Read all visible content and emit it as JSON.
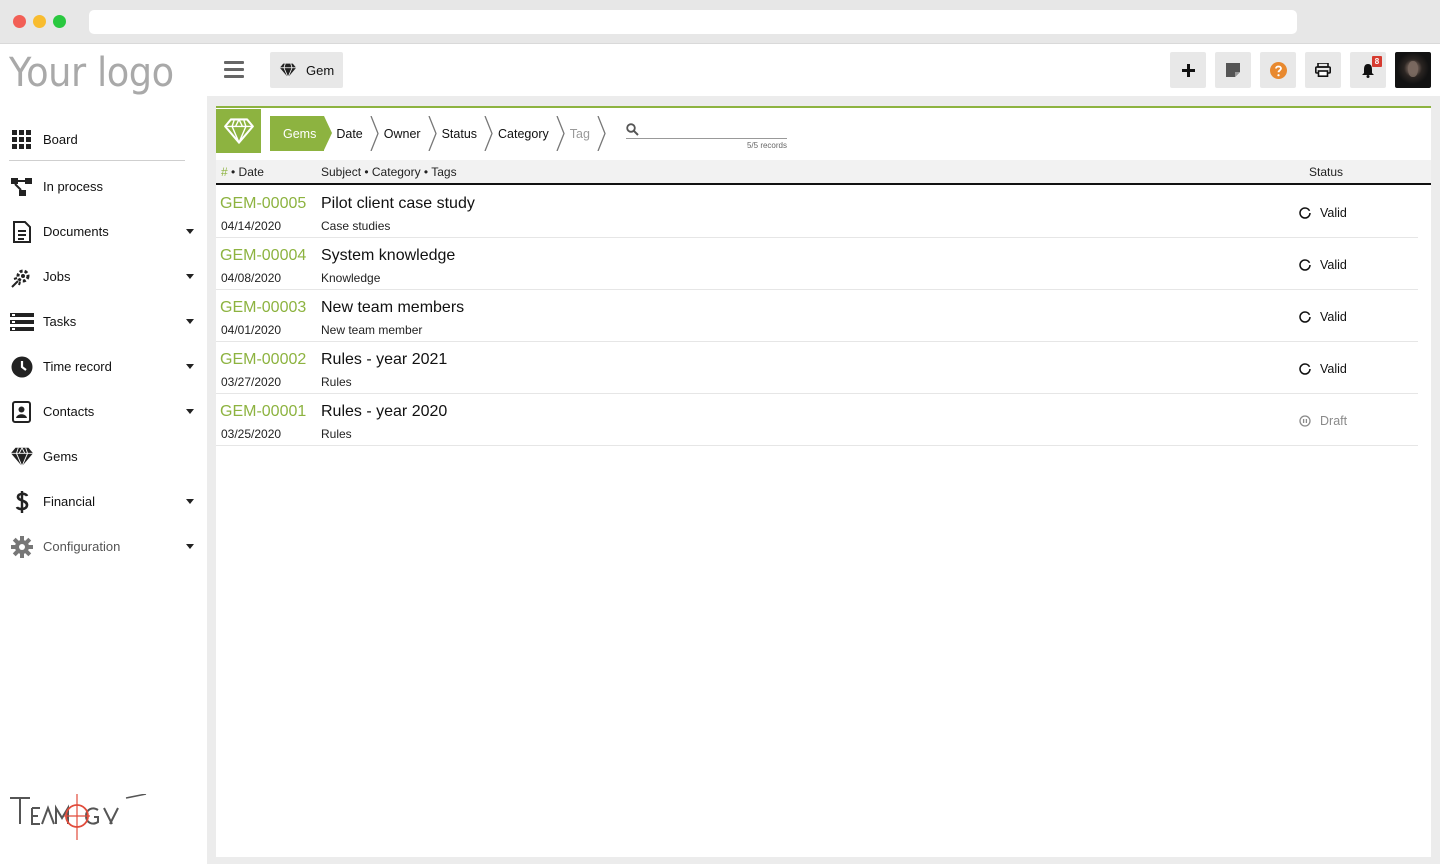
{
  "app": {
    "logo_text": "Your logo",
    "brand_text": "TEAMOLOGY"
  },
  "topbar": {
    "module_label": "Gem",
    "notification_count": "8",
    "buttons": [
      "add",
      "note",
      "help",
      "print",
      "notifications"
    ]
  },
  "sidebar": {
    "items": [
      {
        "label": "Board",
        "icon": "grid-icon",
        "has_caret": false
      },
      {
        "label": "In process",
        "icon": "process-icon",
        "has_caret": false
      },
      {
        "label": "Documents",
        "icon": "document-icon",
        "has_caret": true
      },
      {
        "label": "Jobs",
        "icon": "jobs-icon",
        "has_caret": true
      },
      {
        "label": "Tasks",
        "icon": "tasks-icon",
        "has_caret": true
      },
      {
        "label": "Time record",
        "icon": "clock-icon",
        "has_caret": true
      },
      {
        "label": "Contacts",
        "icon": "contacts-icon",
        "has_caret": true
      },
      {
        "label": "Gems",
        "icon": "diamond-icon",
        "has_caret": false
      },
      {
        "label": "Financial",
        "icon": "dollar-icon",
        "has_caret": true
      },
      {
        "label": "Configuration",
        "icon": "gear-icon",
        "has_caret": true
      }
    ]
  },
  "filters": {
    "items": [
      "Gems",
      "Date",
      "Owner",
      "Status",
      "Category",
      "Tag"
    ],
    "active": "Gems",
    "disabled": "Tag",
    "search_value": "",
    "records_text": "5/5 records"
  },
  "table": {
    "col_hash": "#",
    "col_date": " • Date",
    "col_subject": "Subject • Category • Tags",
    "col_status": "Status",
    "rows": [
      {
        "id": "GEM-00005",
        "date": "04/14/2020",
        "subject": "Pilot client case study",
        "category": "Case studies",
        "status": "Valid"
      },
      {
        "id": "GEM-00004",
        "date": "04/08/2020",
        "subject": "System knowledge",
        "category": "Knowledge",
        "status": "Valid"
      },
      {
        "id": "GEM-00003",
        "date": "04/01/2020",
        "subject": "New team members",
        "category": "New team member",
        "status": "Valid"
      },
      {
        "id": "GEM-00002",
        "date": "03/27/2020",
        "subject": "Rules - year 2021",
        "category": "Rules",
        "status": "Valid"
      },
      {
        "id": "GEM-00001",
        "date": "03/25/2020",
        "subject": "Rules - year 2020",
        "category": "Rules",
        "status": "Draft"
      }
    ]
  },
  "colors": {
    "accent": "#8db340",
    "help": "#e8892f",
    "badge": "#d63b30"
  }
}
